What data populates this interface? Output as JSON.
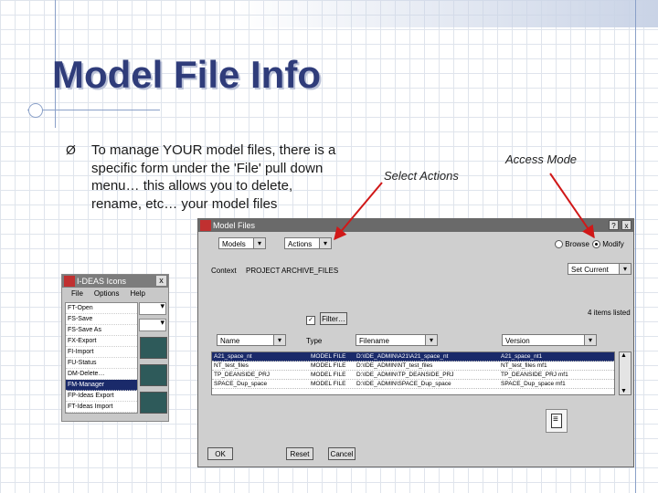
{
  "slide": {
    "title": "Model File Info",
    "bullet_text": "To manage YOUR model files, there is  a specific form under the 'File' pull down menu… this allows you to delete, rename, etc… your model files",
    "bullet_glyph": "Ø",
    "callouts": {
      "select_actions": "Select Actions",
      "access_mode": "Access Mode"
    }
  },
  "ideas_icons": {
    "title": "I-DEAS Icons",
    "close": "x",
    "menu": [
      "File",
      "Options",
      "Help"
    ],
    "items": [
      "FT-Open",
      "FS-Save",
      "FS-Save As",
      "FX-Export",
      "FI-Import",
      "FU-Status",
      "DM-Delete…",
      "FM-Manager",
      "FP-Ideas Export",
      "FT-Ideas Import"
    ],
    "selected_index": 7
  },
  "dialog": {
    "title": "Model Files",
    "help_btn": "?",
    "close_btn": "x",
    "category_select": "Models",
    "actions_select": "Actions",
    "mode_browse": "Browse",
    "mode_modify": "Modify",
    "context_label": "Context",
    "context_value": "PROJECT  ARCHIVE_FILES",
    "set_current_select": "Set Current",
    "filter_btn": "Filter…",
    "items_count": "4 items listed",
    "col_name": "Name",
    "col_type_label": "Type",
    "col_filename": "Filename",
    "col_version": "Version",
    "rows": [
      {
        "name": "A21_space_nt",
        "type": "MODEL FILE",
        "file": "D:\\IDE_ADMIN\\A21\\A21_space_nt",
        "ver": "A21_space_nt1",
        "selected": true
      },
      {
        "name": "NT_test_files",
        "type": "MODEL FILE",
        "file": "D:\\IDE_ADMIN\\NT_test_files",
        "ver": "NT_test_files mf1",
        "selected": false
      },
      {
        "name": "TP_DEANSIDE_PRJ",
        "type": "MODEL FILE",
        "file": "D:\\IDE_ADMIN\\TP_DEANSIDE_PRJ",
        "ver": "TP_DEANSIDE_PRJ mf1",
        "selected": false
      },
      {
        "name": "SPACE_Dup_space",
        "type": "MODEL FILE",
        "file": "D:\\IDE_ADMIN\\SPACE_Dup_space",
        "ver": "SPACE_Dup_space mf1",
        "selected": false
      }
    ],
    "ok_btn": "OK",
    "reset_btn": "Reset",
    "cancel_btn": "Cancel"
  },
  "colors": {
    "title": "#2f3c7a",
    "arrow": "#d01818",
    "selection": "#1a2a6a"
  }
}
